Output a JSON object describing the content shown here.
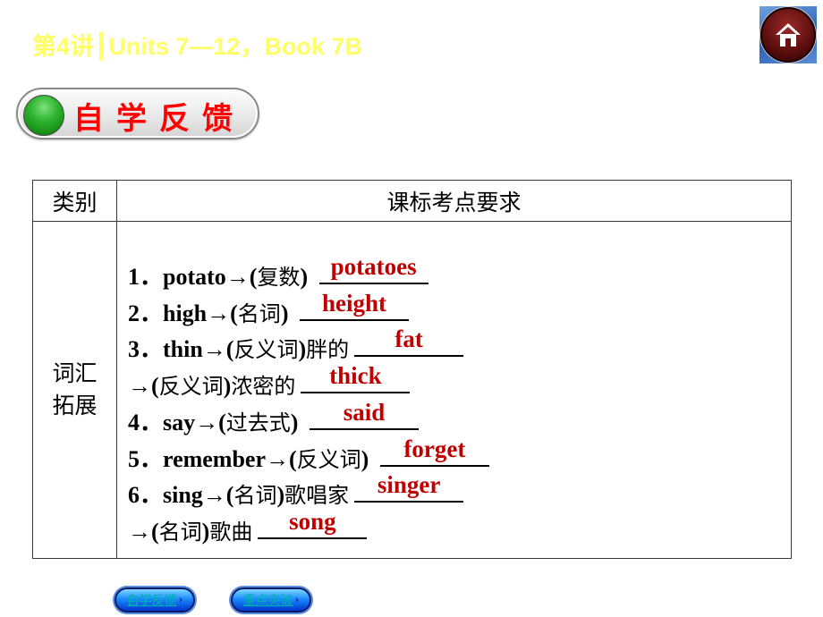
{
  "header": {
    "title": "第4讲┃Units 7—12，Book 7B",
    "home_icon": "home-icon"
  },
  "section": {
    "label": "自学反馈",
    "indicator_icon": "green-dot-icon"
  },
  "table": {
    "headers": [
      "类别",
      "课标考点要求"
    ],
    "category": "词汇拓展",
    "items": [
      {
        "prefix": "1．potato→(",
        "cn": "复数",
        "suffix": ") ",
        "answer": "potatoes"
      },
      {
        "prefix": "2．high→(",
        "cn": "名词",
        "suffix": ") ",
        "answer": "height"
      },
      {
        "prefix": "3．thin→(",
        "cn": "反义词",
        "suffix": ")",
        "cn2": "胖的",
        "answer": "fat"
      },
      {
        "prefix": "→(",
        "cn": "反义词",
        "suffix": ")",
        "cn2": "浓密的",
        "answer": "thick"
      },
      {
        "prefix": "4．say→(",
        "cn": "过去式",
        "suffix": ") ",
        "answer": "said"
      },
      {
        "prefix": "5．remember→(",
        "cn": "反义词",
        "suffix": ") ",
        "answer": "forget"
      },
      {
        "prefix": "6．sing→(",
        "cn": "名词",
        "suffix": ")",
        "cn2": "歌唱家",
        "answer": "singer"
      },
      {
        "prefix": "→(",
        "cn": "名词",
        "suffix": ")",
        "cn2": "歌曲",
        "answer": "song"
      }
    ]
  },
  "footer_nav": [
    {
      "label": "自学反馈",
      "icon": "chevron-right-icon"
    },
    {
      "label": "重点突破",
      "icon": "chevron-right-icon"
    }
  ],
  "colors": {
    "title": "#ffff66",
    "section_label": "#ff0000",
    "answer": "#c00000"
  }
}
